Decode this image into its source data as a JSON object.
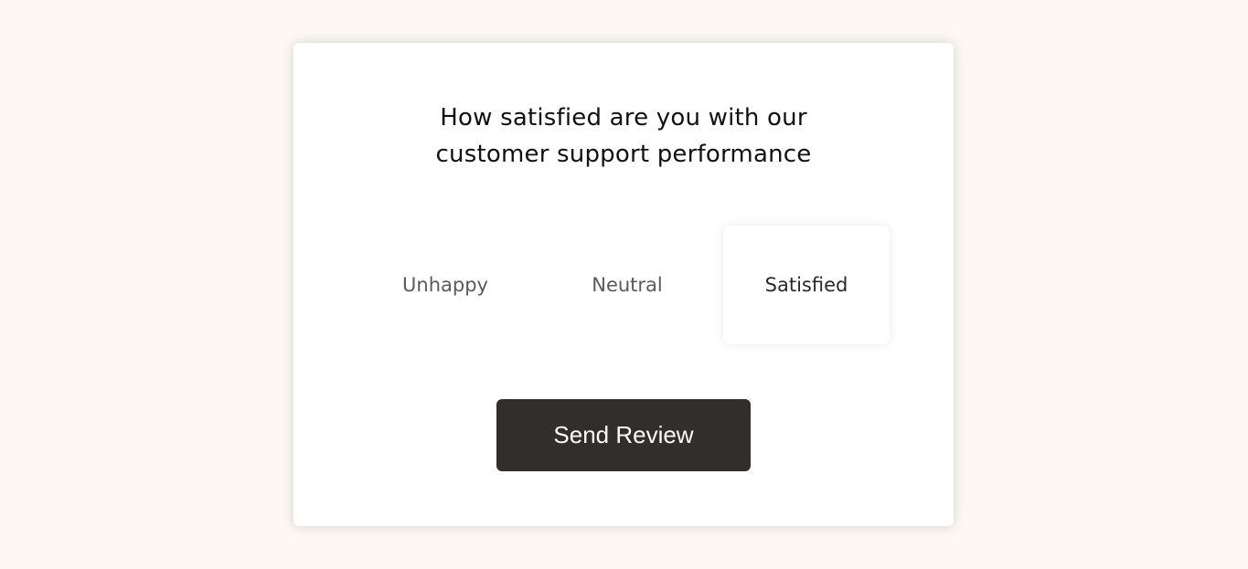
{
  "survey": {
    "question_line1": "How satisfied are you with our",
    "question_line2": "customer support performance",
    "options": [
      {
        "label": "Unhappy",
        "selected": false
      },
      {
        "label": "Neutral",
        "selected": false
      },
      {
        "label": "Satisfied",
        "selected": true
      }
    ],
    "submit_label": "Send Review"
  },
  "colors": {
    "page_background": "#fdf8f3",
    "card_background": "#ffffff",
    "button_background": "#322e2b",
    "button_text": "#ffffff"
  }
}
